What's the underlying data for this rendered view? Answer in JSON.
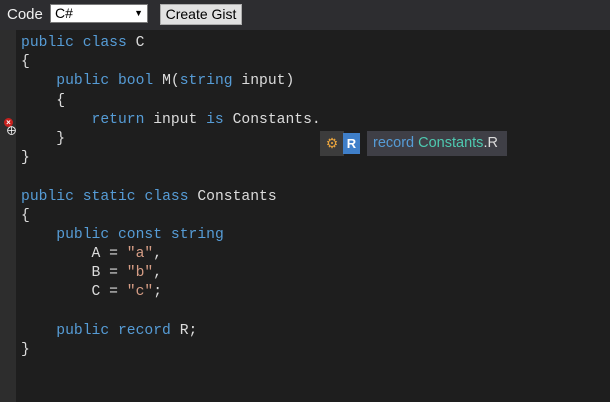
{
  "toolbar": {
    "code_label": "Code",
    "language_value": "C#",
    "create_gist_label": "Create Gist"
  },
  "code_lines": [
    [
      {
        "t": "public",
        "c": "kw"
      },
      {
        "t": " "
      },
      {
        "t": "class",
        "c": "kw"
      },
      {
        "t": " C"
      }
    ],
    [
      {
        "t": "{"
      }
    ],
    [
      {
        "t": "    "
      },
      {
        "t": "public",
        "c": "kw"
      },
      {
        "t": " "
      },
      {
        "t": "bool",
        "c": "kw"
      },
      {
        "t": " M("
      },
      {
        "t": "string",
        "c": "kw"
      },
      {
        "t": " input)"
      }
    ],
    [
      {
        "t": "    {"
      }
    ],
    [
      {
        "t": "        "
      },
      {
        "t": "return",
        "c": "kw"
      },
      {
        "t": " input "
      },
      {
        "t": "is",
        "c": "kw"
      },
      {
        "t": " Constants."
      }
    ],
    [
      {
        "t": "    }"
      }
    ],
    [
      {
        "t": "}"
      }
    ],
    [],
    [
      {
        "t": "public",
        "c": "kw"
      },
      {
        "t": " "
      },
      {
        "t": "static",
        "c": "kw"
      },
      {
        "t": " "
      },
      {
        "t": "class",
        "c": "kw"
      },
      {
        "t": " Constants"
      }
    ],
    [
      {
        "t": "{"
      }
    ],
    [
      {
        "t": "    "
      },
      {
        "t": "public",
        "c": "kw"
      },
      {
        "t": " "
      },
      {
        "t": "const",
        "c": "kw"
      },
      {
        "t": " "
      },
      {
        "t": "string",
        "c": "kw"
      }
    ],
    [
      {
        "t": "        A = "
      },
      {
        "t": "\"a\"",
        "c": "str"
      },
      {
        "t": ","
      }
    ],
    [
      {
        "t": "        B = "
      },
      {
        "t": "\"b\"",
        "c": "str"
      },
      {
        "t": ","
      }
    ],
    [
      {
        "t": "        C = "
      },
      {
        "t": "\"c\"",
        "c": "str"
      },
      {
        "t": ";"
      }
    ],
    [],
    [
      {
        "t": "    "
      },
      {
        "t": "public",
        "c": "kw"
      },
      {
        "t": " "
      },
      {
        "t": "record",
        "c": "kw"
      },
      {
        "t": " R;"
      }
    ],
    [
      {
        "t": "}"
      }
    ]
  ],
  "completion": {
    "icon": "intellisense-icon",
    "member_badge": "R",
    "tip_keyword": "record",
    "tip_type": "Constants",
    "tip_sep": ".",
    "tip_member": "R"
  },
  "gutter": {
    "error_icon": "error-icon",
    "error_line": 5
  },
  "colors": {
    "editor_bg": "#1e1e1e",
    "keyword": "#569cd6",
    "type": "#4ec9b0",
    "string": "#d69d85",
    "error": "#c8211e"
  }
}
